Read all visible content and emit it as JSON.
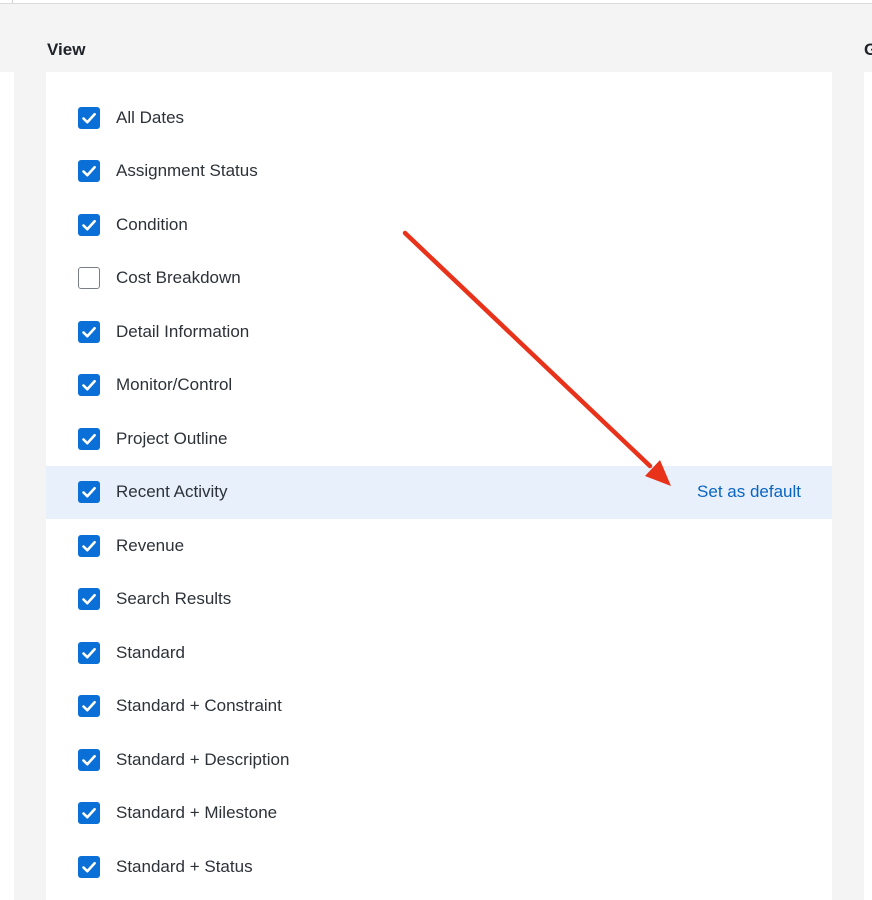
{
  "section_title": "View",
  "next_section_title": "G",
  "set_default_label": "Set as default",
  "colors": {
    "checkbox_checked": "#0a6fd6",
    "row_highlight": "#e8f0fb",
    "link": "#0a65c2",
    "annotation_arrow": "#e8321a"
  },
  "views": [
    {
      "label": "All Dates",
      "checked": true
    },
    {
      "label": "Assignment Status",
      "checked": true
    },
    {
      "label": "Condition",
      "checked": true
    },
    {
      "label": "Cost Breakdown",
      "checked": false
    },
    {
      "label": "Detail Information",
      "checked": true
    },
    {
      "label": "Monitor/Control",
      "checked": true
    },
    {
      "label": "Project Outline",
      "checked": true
    },
    {
      "label": "Recent Activity",
      "checked": true,
      "highlighted": true
    },
    {
      "label": "Revenue",
      "checked": true
    },
    {
      "label": "Search Results",
      "checked": true
    },
    {
      "label": "Standard",
      "checked": true
    },
    {
      "label": "Standard + Constraint",
      "checked": true
    },
    {
      "label": "Standard + Description",
      "checked": true
    },
    {
      "label": "Standard + Milestone",
      "checked": true
    },
    {
      "label": "Standard + Status",
      "checked": true
    }
  ]
}
